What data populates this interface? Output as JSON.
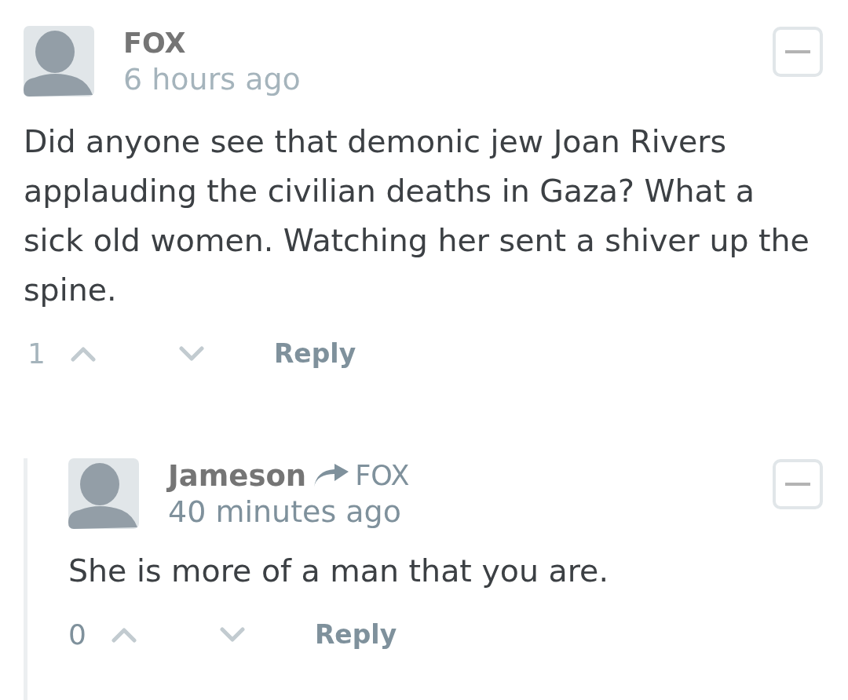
{
  "comments": [
    {
      "author": "FOX",
      "time": "6 hours ago",
      "expanded": true,
      "body": "Did anyone see that demonic jew Joan Rivers applauding the civilian deaths in Gaza? What a sick old women. Watching her sent a shiver up the spine.",
      "score": "1",
      "reply_label": "Reply",
      "children": [
        {
          "author": "Jameson",
          "reply_to": "FOX",
          "time": "40 minutes ago",
          "expanded": true,
          "body": "She is more of a man that you are.",
          "score": "0",
          "reply_label": "Reply"
        }
      ]
    }
  ]
}
